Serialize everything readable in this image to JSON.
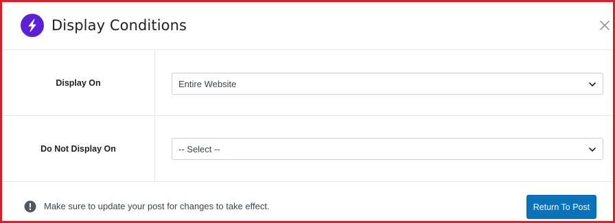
{
  "dialog": {
    "title": "Display Conditions",
    "logo_icon": "spectra-logo-icon",
    "close_icon": "close-icon"
  },
  "conditions": {
    "display_on": {
      "label": "Display On",
      "selected": "Entire Website"
    },
    "do_not_display_on": {
      "label": "Do Not Display On",
      "selected": "-- Select --"
    }
  },
  "footer": {
    "notice_icon": "info-icon",
    "notice": "Make sure to update your post for changes to take effect.",
    "button_label": "Return To Post"
  },
  "colors": {
    "accent": "#0a72b8",
    "logo": "#5b21d6",
    "highlight_border": "#d0242b"
  }
}
